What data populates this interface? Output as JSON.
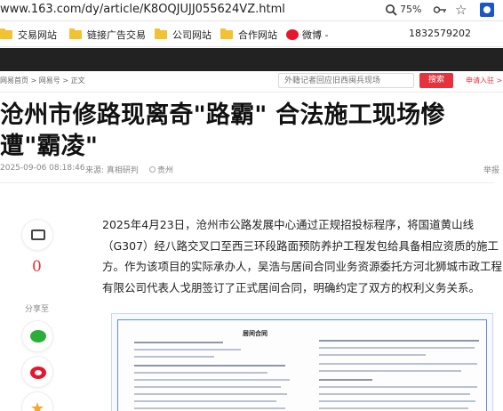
{
  "browser": {
    "url": "www.163.com/dy/article/K8OQJUJJ055624VZ.html",
    "zoom": "75%"
  },
  "bookmarks": [
    {
      "label": "交易网站"
    },
    {
      "label": "链接广告交易"
    },
    {
      "label": "公司网站"
    },
    {
      "label": "合作网站"
    },
    {
      "label": "微博 -"
    }
  ],
  "bookmark_phone": "1832579202",
  "site": {
    "breadcrumb": "网易首页 > 网易号 > 正文",
    "search_placeholder": "外籍记者回应旧西闽兵现场",
    "search_button": "搜索",
    "login": "申请入驻 >"
  },
  "article": {
    "title": "沧州市修路现离奇\"路霸\" 合法施工现场惨遭\"霸凌\"",
    "date": "2025-09-06 08:18:46",
    "source": "来源: 真相研判",
    "location": "贵州",
    "report": "举报",
    "paragraph": "2025年4月23日，沧州市公路发展中心通过正规招投标程序，将国道黄山线（G307）经八路交叉口至西三环段路面预防养护工程发包给具备相应资质的施工方。作为该项目的实际承办人，吴浩与居间合同业务资源委托方河北狮城市政工程有限公司代表人戈朋签订了正式居间合同，明确约定了双方的权利义务关系。",
    "comment_count": "0",
    "share_label": "分享至",
    "doc_image_title": "居间合同"
  },
  "icons": [
    "search-icon",
    "key-icon",
    "star-icon",
    "extension-icon",
    "folder-icon",
    "weibo-icon",
    "comment-icon",
    "wechat-icon",
    "weibo-share-icon",
    "qzone-icon",
    "location-icon"
  ]
}
